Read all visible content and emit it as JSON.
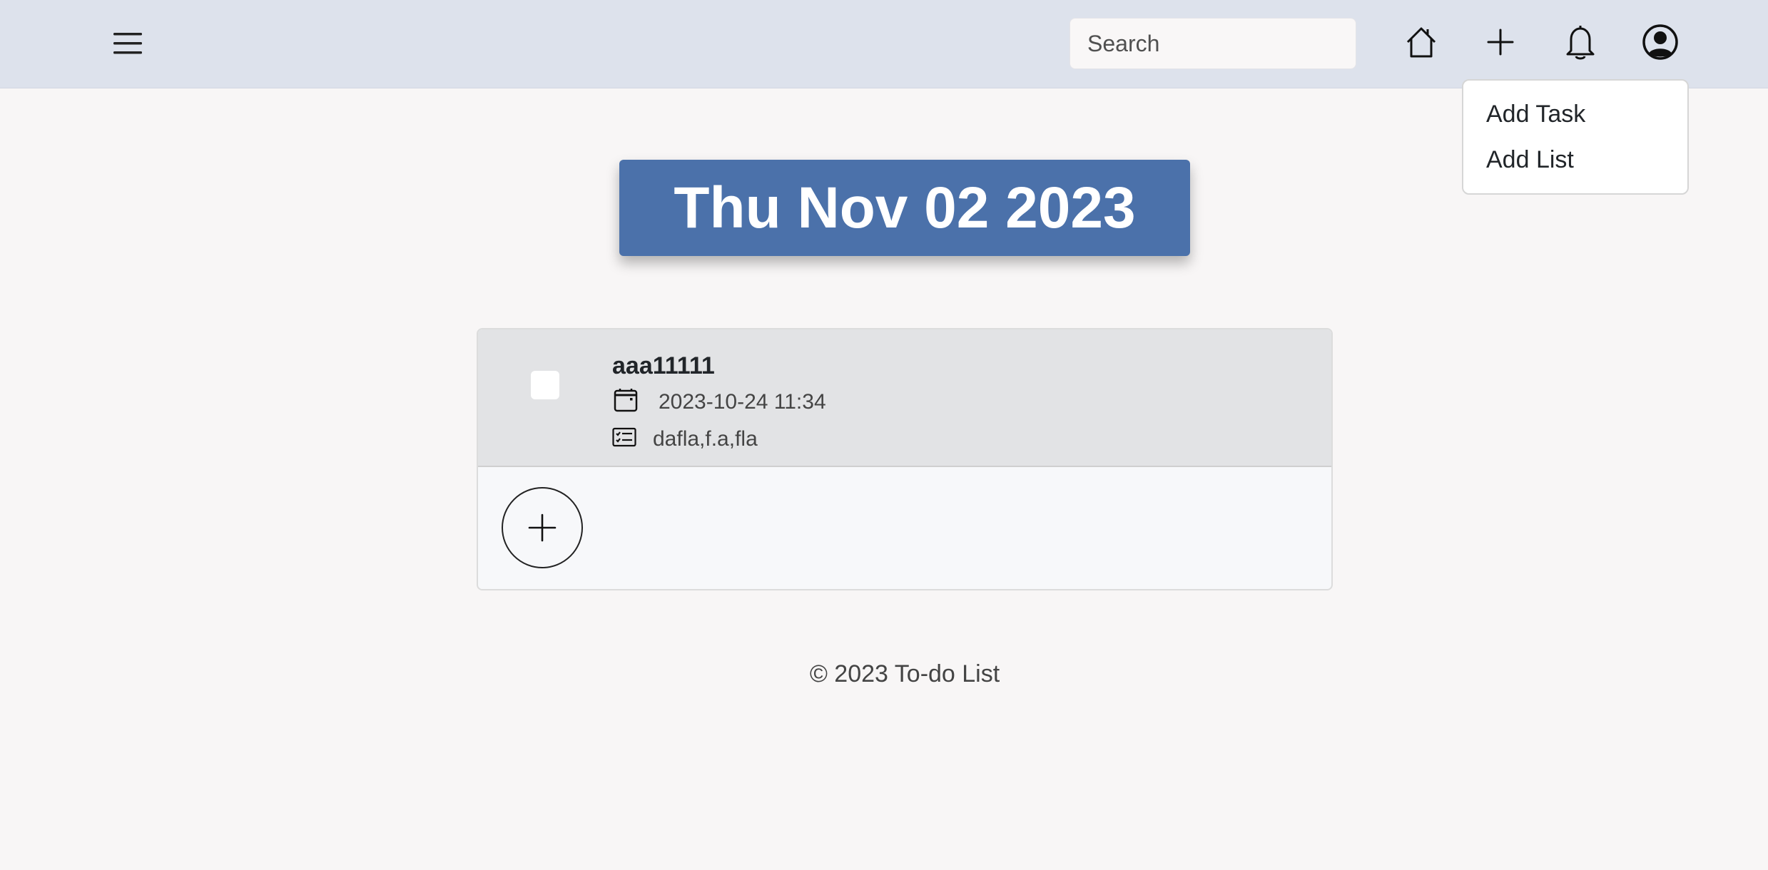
{
  "navbar": {
    "menu_icon": "hamburger-menu-icon",
    "search": {
      "placeholder": "Search",
      "value": ""
    },
    "home_icon": "home-icon",
    "add_icon": "plus-icon",
    "notifications_icon": "bell-icon",
    "profile_icon": "user-circle-icon",
    "add_dropdown": {
      "items": [
        {
          "label": "Add Task"
        },
        {
          "label": "Add List"
        }
      ]
    }
  },
  "main": {
    "date_banner": "Thu Nov 02 2023",
    "tasks": [
      {
        "title": "aaa11111",
        "due": "2023-10-24 11:34",
        "description": "dafla,f.a,fla",
        "checked": false
      }
    ],
    "add_task_icon": "plus-circle-icon"
  },
  "footer": {
    "text": "© 2023 To-do List"
  },
  "colors": {
    "navbar_bg": "#dde2ec",
    "page_bg": "#f8f6f6",
    "date_banner_bg": "#4b71aa",
    "task_row_bg": "#e2e3e5"
  }
}
